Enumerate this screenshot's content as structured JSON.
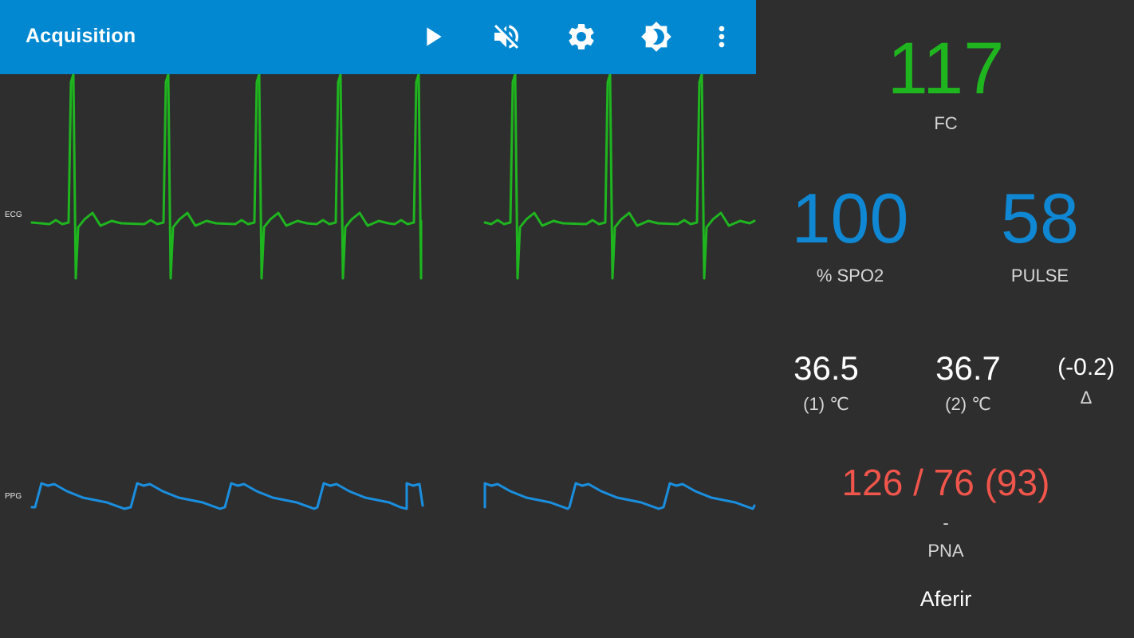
{
  "appbar": {
    "title": "Acquisition",
    "color": "#0288d1",
    "actions": [
      {
        "name": "play",
        "icon": "play-icon"
      },
      {
        "name": "mute",
        "icon": "volume-off-icon"
      },
      {
        "name": "settings",
        "icon": "gear-icon"
      },
      {
        "name": "brightness",
        "icon": "brightness-icon"
      },
      {
        "name": "more",
        "icon": "more-vert-icon"
      }
    ]
  },
  "traces": {
    "ecg": {
      "label": "ECG",
      "color": "#1fb51f"
    },
    "ppg": {
      "label": "PPG",
      "color": "#1a8fe0"
    }
  },
  "vitals": {
    "fc": {
      "value": "117",
      "label": "FC",
      "color": "#1fb51f"
    },
    "spo2": {
      "value": "100",
      "label": "% SPO2",
      "color": "#0f87d2"
    },
    "pulse": {
      "value": "58",
      "label": "PULSE",
      "color": "#0f87d2"
    },
    "temp1": {
      "value": "36.5",
      "label": "(1) ℃"
    },
    "temp2": {
      "value": "36.7",
      "label": "(2) ℃"
    },
    "temp_delta": {
      "value": "(-0.2)",
      "label": "Δ"
    },
    "bp": {
      "value": "126 / 76 (93)",
      "status": "-",
      "label": "PNA",
      "color": "#f0554b"
    }
  },
  "measure_button": {
    "label": "Aferir"
  }
}
